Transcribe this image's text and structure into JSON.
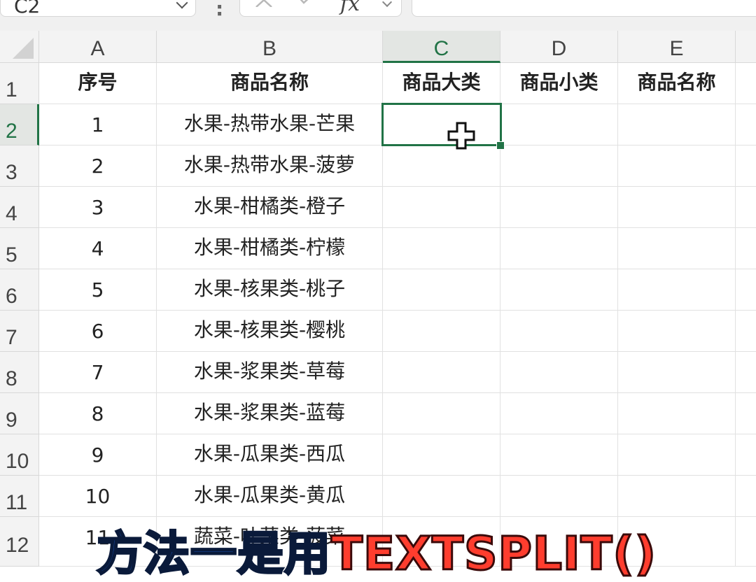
{
  "namebox": {
    "value": "C2"
  },
  "formula_bar": {
    "fx_label": "fx",
    "separator": ":"
  },
  "columns": [
    "A",
    "B",
    "C",
    "D",
    "E"
  ],
  "rows": [
    "1",
    "2",
    "3",
    "4",
    "5",
    "6",
    "7",
    "8",
    "9",
    "10",
    "11",
    "12"
  ],
  "headers": [
    "序号",
    "商品名称",
    "商品大类",
    "商品小类",
    "商品名称"
  ],
  "data": [
    {
      "no": "1",
      "name": "水果-热带水果-芒果"
    },
    {
      "no": "2",
      "name": "水果-热带水果-菠萝"
    },
    {
      "no": "3",
      "name": "水果-柑橘类-橙子"
    },
    {
      "no": "4",
      "name": "水果-柑橘类-柠檬"
    },
    {
      "no": "5",
      "name": "水果-核果类-桃子"
    },
    {
      "no": "6",
      "name": "水果-核果类-樱桃"
    },
    {
      "no": "7",
      "name": "水果-浆果类-草莓"
    },
    {
      "no": "8",
      "name": "水果-浆果类-蓝莓"
    },
    {
      "no": "9",
      "name": "水果-瓜果类-西瓜"
    },
    {
      "no": "10",
      "name": "水果-瓜果类-黄瓜"
    },
    {
      "no": "11",
      "name": "蔬菜-叶菜类-菠菜"
    }
  ],
  "caption": {
    "part1": "方法一是用",
    "part2": "TEXTSPLIT()"
  },
  "colors": {
    "accent": "#217346",
    "caption_blue": "#1c5fd6",
    "caption_red": "#ff3d2e"
  }
}
